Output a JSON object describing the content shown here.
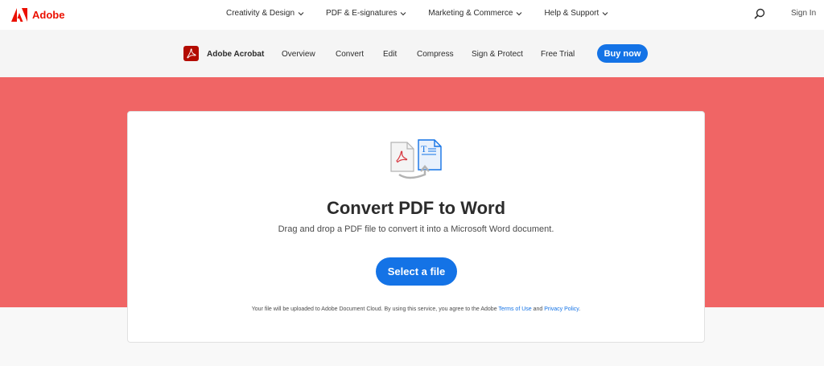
{
  "brand": {
    "name": "Adobe",
    "color": "#eb1000"
  },
  "gnav": {
    "items": [
      {
        "label": "Creativity & Design"
      },
      {
        "label": "PDF & E-signatures"
      },
      {
        "label": "Marketing & Commerce"
      },
      {
        "label": "Help & Support"
      }
    ],
    "search_icon": "search-icon",
    "sign_in": "Sign In"
  },
  "lnav": {
    "product": "Adobe Acrobat",
    "links": [
      "Overview",
      "Convert",
      "Edit",
      "Compress",
      "Sign & Protect",
      "Free Trial"
    ],
    "buy": "Buy now"
  },
  "hero": {
    "title": "Convert PDF to Word",
    "subtitle": "Drag and drop a PDF file to convert it into a Microsoft Word document.",
    "button": "Select a file",
    "legal_prefix": "Your file will be uploaded to Adobe Document Cloud.  By using this service, you agree to the Adobe ",
    "terms": "Terms of Use",
    "and": " and ",
    "privacy": "Privacy Policy",
    "legal_suffix": "."
  },
  "colors": {
    "accent": "#1473e6",
    "hero": "#f06565",
    "acrobat": "#b30b00"
  }
}
